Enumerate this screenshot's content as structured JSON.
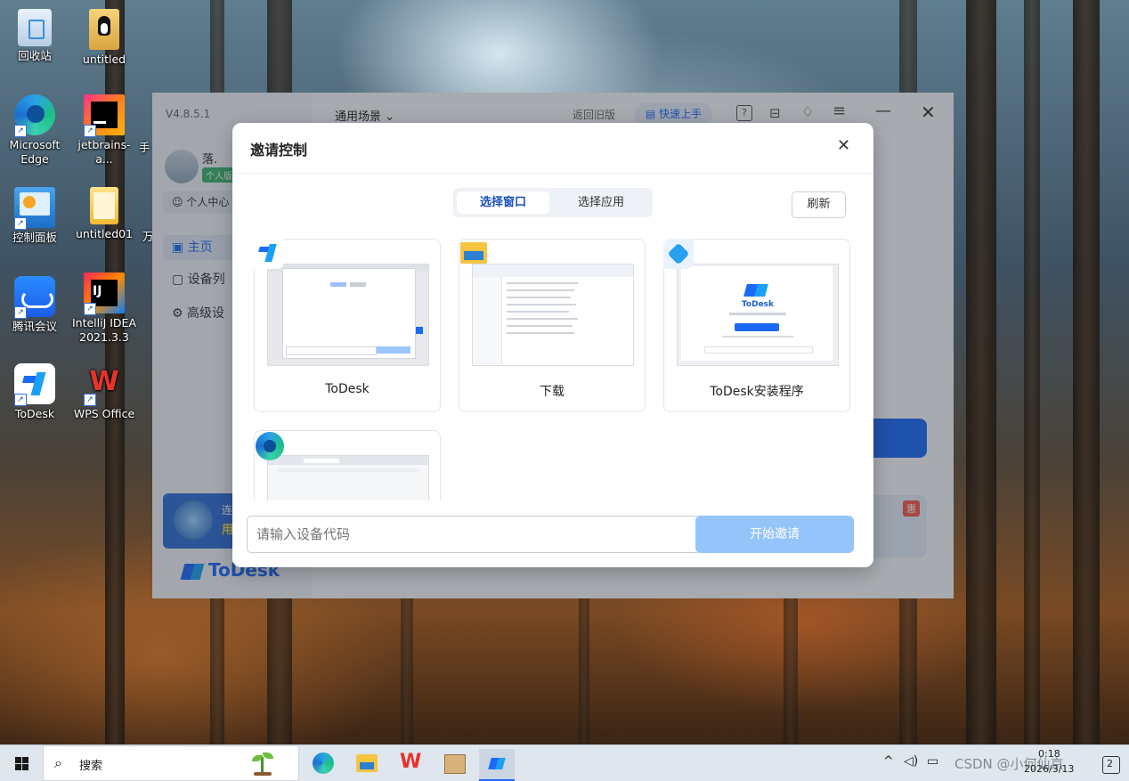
{
  "desktop": {
    "icons": [
      {
        "label": "回收站",
        "icon": "recycle-bin-icon"
      },
      {
        "label": "untitled",
        "icon": "linux-tux-icon"
      },
      {
        "label": "Microsoft Edge",
        "icon": "edge-icon"
      },
      {
        "label": "jetbrains-a...",
        "icon": "jetbrains-icon"
      },
      {
        "label": "控制面板",
        "icon": "control-panel-icon"
      },
      {
        "label": "untitled01",
        "icon": "folder-icon"
      },
      {
        "label": "腾讯会议",
        "icon": "tencent-meeting-icon"
      },
      {
        "label": "IntelliJ IDEA 2021.3.3",
        "icon": "intellij-icon"
      },
      {
        "label": "ToDesk",
        "icon": "todesk-icon"
      },
      {
        "label": "WPS Office",
        "icon": "wps-icon"
      }
    ],
    "partial_labels": [
      "手",
      "万"
    ]
  },
  "todesk": {
    "version": "V4.8.5.1",
    "scene_dropdown": "通用场景",
    "old_version": "返回旧版",
    "quick_start": "快速上手",
    "user_name": "落.",
    "user_badge": "个人版",
    "personal_center": "个人中心",
    "nav": [
      "主页",
      "设备列",
      "高级设"
    ],
    "promo_lines": [
      "连",
      "用"
    ],
    "promo_tag": "惠",
    "logo_text": "ToDesk",
    "colors": {
      "accent": "#1a6af5",
      "primary_disabled": "#95c4fb"
    }
  },
  "modal": {
    "title": "邀请控制",
    "tabs": [
      {
        "label": "选择窗口",
        "active": true
      },
      {
        "label": "选择应用",
        "active": false
      }
    ],
    "refresh": "刷新",
    "windows": [
      {
        "title": "ToDesk",
        "icon": "todesk-icon"
      },
      {
        "title": "下载",
        "icon": "file-explorer-icon"
      },
      {
        "title": "ToDesk安装程序",
        "icon": "todesk-installer-icon"
      },
      {
        "title": "",
        "icon": "edge-icon"
      }
    ],
    "installer_preview": {
      "brand": "ToDesk"
    },
    "input_placeholder": "请输入设备代码",
    "start_button": "开始邀请"
  },
  "taskbar": {
    "search": "搜索",
    "apps": [
      "edge-icon",
      "file-explorer-icon",
      "wps-icon",
      "package-icon",
      "todesk-icon"
    ],
    "time": "0:18",
    "date": "2026/3/13",
    "notification_count": "2",
    "watermark": "CSDN @小何仙京"
  }
}
